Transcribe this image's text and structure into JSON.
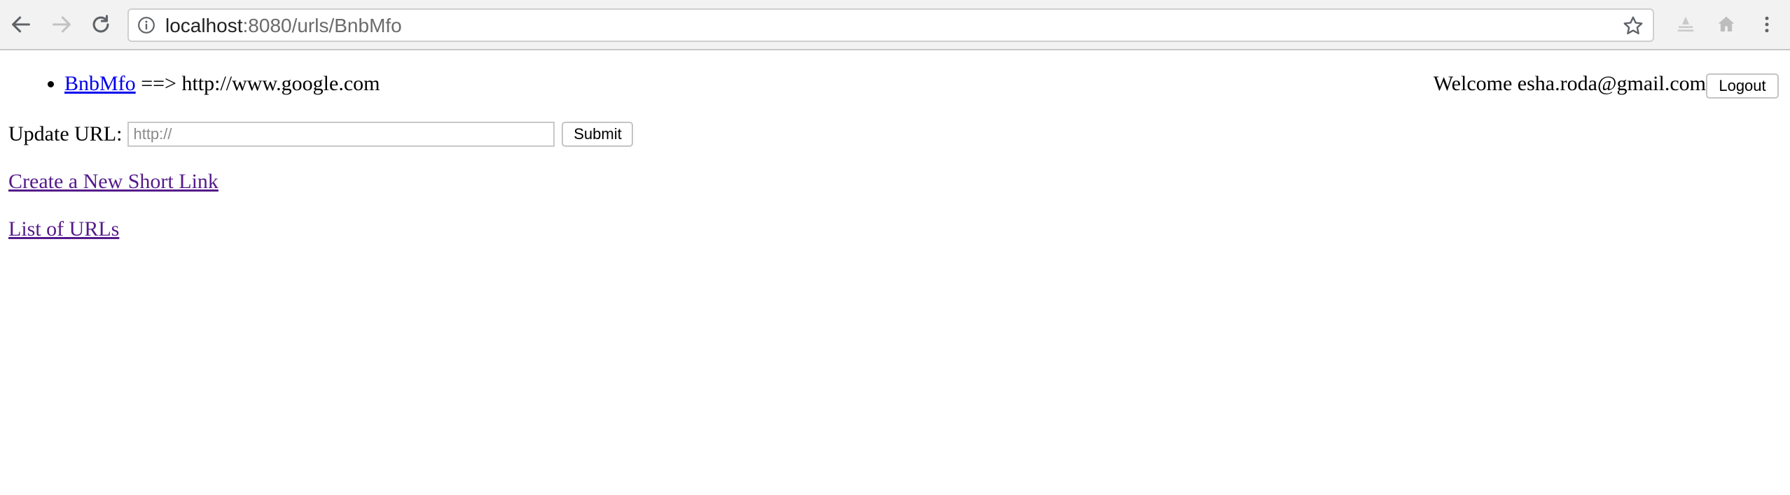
{
  "browser": {
    "url_host": "localhost",
    "url_path": ":8080/urls/BnbMfo",
    "icons": {
      "back": "back-arrow-icon",
      "forward": "forward-arrow-icon",
      "reload": "reload-icon",
      "info": "info-icon",
      "bookmark": "star-icon",
      "extension": "extension-icon",
      "home": "home-icon",
      "menu": "menu-dots-icon"
    }
  },
  "url_entry": {
    "short_code": "BnbMfo",
    "arrow": "==>",
    "long_url": "http://www.google.com"
  },
  "header": {
    "welcome_prefix": "Welcome",
    "email": "esha.roda@gmail.com",
    "logout_label": "Logout"
  },
  "update_form": {
    "label": "Update URL:",
    "placeholder": "http://",
    "value": "",
    "submit_label": "Submit"
  },
  "links": {
    "create_new": "Create a New Short Link",
    "list_urls": "List of URLs"
  },
  "colors": {
    "link_unvisited": "#0000ee",
    "link_visited": "#551a8b",
    "chrome_bg": "#f2f2f2"
  }
}
